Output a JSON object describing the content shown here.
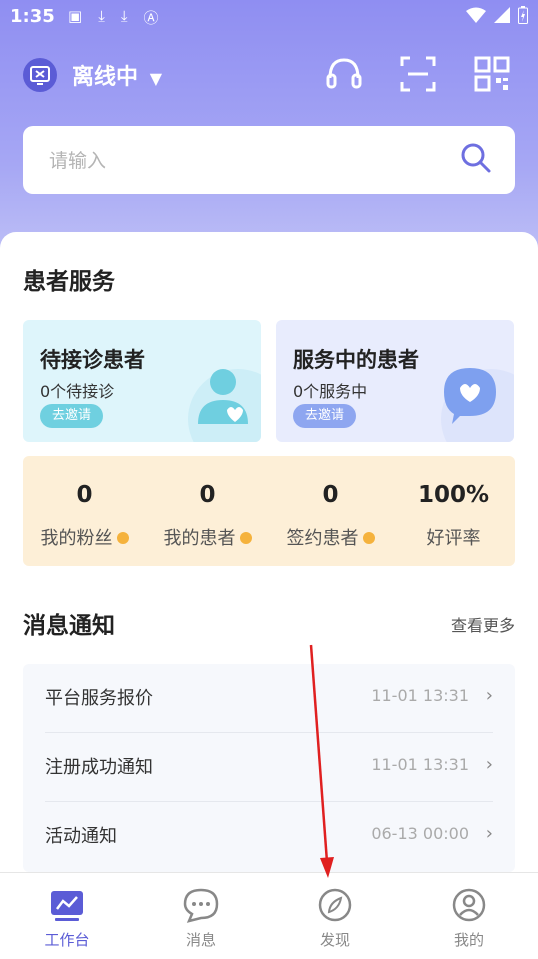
{
  "status_bar": {
    "time": "1:35"
  },
  "header": {
    "status_label": "离线中"
  },
  "search": {
    "placeholder": "请输入"
  },
  "patient_service": {
    "title": "患者服务",
    "waiting": {
      "title": "待接诊患者",
      "subtitle": "0个待接诊",
      "button": "去邀请"
    },
    "in_service": {
      "title": "服务中的患者",
      "subtitle": "0个服务中",
      "button": "去邀请"
    }
  },
  "stats": [
    {
      "value": "0",
      "label": "我的粉丝"
    },
    {
      "value": "0",
      "label": "我的患者"
    },
    {
      "value": "0",
      "label": "签约患者"
    },
    {
      "value": "100%",
      "label": "好评率"
    }
  ],
  "notices": {
    "title": "消息通知",
    "more": "查看更多",
    "items": [
      {
        "title": "平台服务报价",
        "time": "11-01 13:31"
      },
      {
        "title": "注册成功通知",
        "time": "11-01 13:31"
      },
      {
        "title": "活动通知",
        "time": "06-13 00:00"
      }
    ]
  },
  "tabs": [
    {
      "label": "工作台",
      "active": true,
      "icon": "chart-icon"
    },
    {
      "label": "消息",
      "active": false,
      "icon": "chat-icon"
    },
    {
      "label": "发现",
      "active": false,
      "icon": "compass-icon"
    },
    {
      "label": "我的",
      "active": false,
      "icon": "profile-icon"
    }
  ],
  "colors": {
    "accent": "#5b5cd6",
    "annotation_arrow": "#e02020"
  }
}
